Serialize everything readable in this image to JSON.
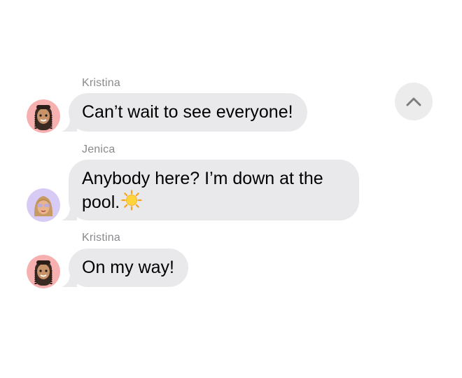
{
  "messages": [
    {
      "sender": "Kristina",
      "text": "Can’t wait to see everyone!",
      "avatar_icon": "memoji-kristina-avatar",
      "avatar_bg": "#f7b2b2"
    },
    {
      "sender": "Jenica",
      "text_line1": "Anybody here? I’m down at the",
      "text_line2": "pool.",
      "emoji_icon": "sun-emoji",
      "avatar_icon": "memoji-jenica-avatar",
      "avatar_bg": "#d9cdf7"
    },
    {
      "sender": "Kristina",
      "text": "On my way!",
      "avatar_icon": "memoji-kristina-avatar",
      "avatar_bg": "#f7b2b2"
    }
  ],
  "scroll_button": {
    "icon": "chevron-up-icon"
  },
  "colors": {
    "bubble": "#e9e9eb",
    "sender_label": "#8a8a8e",
    "scroll_button_bg": "#ececec"
  }
}
